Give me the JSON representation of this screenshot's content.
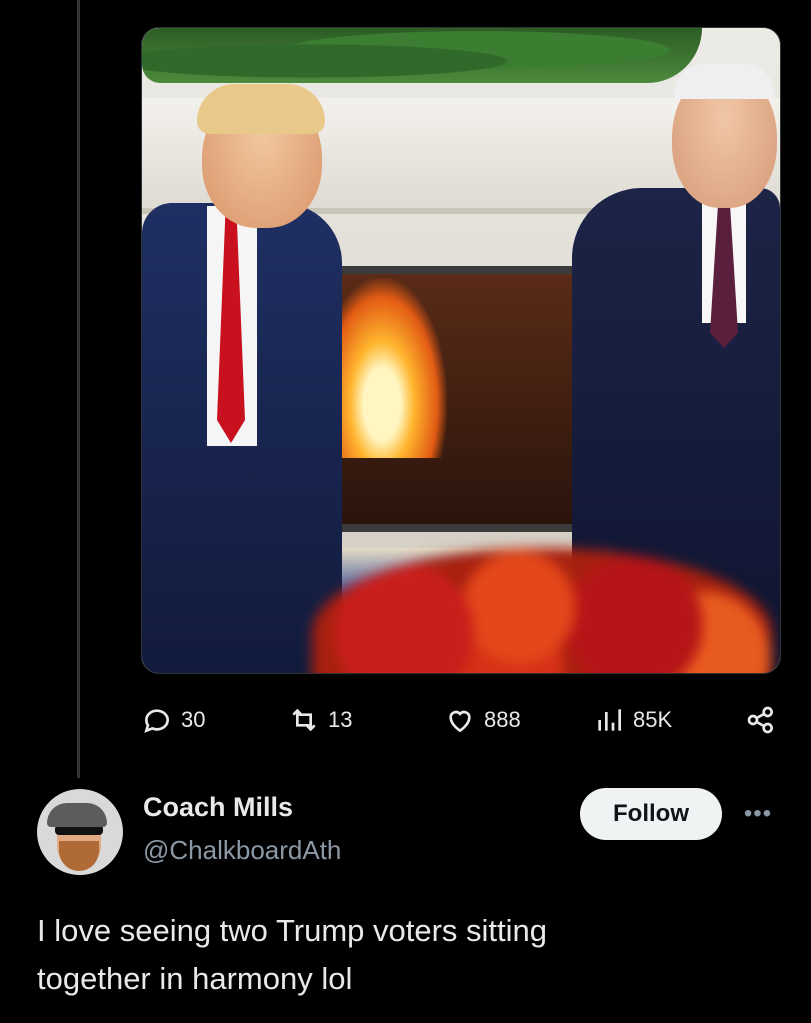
{
  "tweet": {
    "actions": {
      "replies": "30",
      "reposts": "13",
      "likes": "888",
      "views": "85K"
    }
  },
  "reply": {
    "author_name": "Coach Mills",
    "author_handle": "@ChalkboardAth",
    "follow_label": "Follow",
    "more_label": "•••",
    "text": "I love seeing two Trump voters sitting\ntogether in harmony lol"
  },
  "icons": {
    "reply": "chat-bubble-icon",
    "repost": "repost-icon",
    "like": "heart-icon",
    "views": "bar-chart-icon",
    "share": "share-icon"
  },
  "colors": {
    "background": "#000000",
    "text": "#e7e9ea",
    "muted": "#8b98a5",
    "follow_bg": "#eff3f4"
  }
}
